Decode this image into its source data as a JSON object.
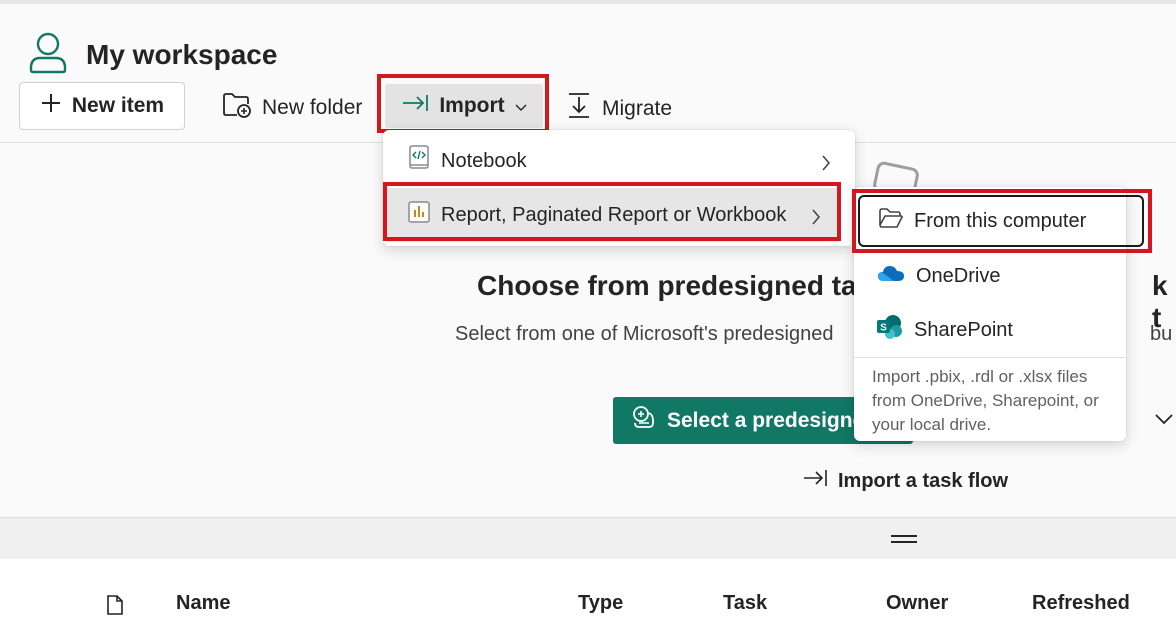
{
  "workspace": {
    "title": "My workspace"
  },
  "toolbar": {
    "new_item": "New item",
    "new_folder": "New folder",
    "import": "Import",
    "migrate": "Migrate"
  },
  "import_menu": {
    "items": [
      {
        "label": "Notebook",
        "icon": "notebook-icon"
      },
      {
        "label": "Report, Paginated Report or Workbook",
        "icon": "report-icon"
      }
    ]
  },
  "import_submenu": {
    "items": [
      {
        "label": "From this computer",
        "icon": "folder-open-icon"
      },
      {
        "label": "OneDrive",
        "icon": "onedrive-icon"
      },
      {
        "label": "SharePoint",
        "icon": "sharepoint-icon"
      }
    ],
    "description": "Import .pbix, .rdl or .xlsx files from OneDrive, Sharepoint, or your local drive."
  },
  "main": {
    "title": "Choose from predesigned ta",
    "title_tail": "k t",
    "subtitle": "Select from one of Microsoft's predesigned",
    "subtitle_tail": "bu",
    "select_button": "Select a predesigne",
    "import_task_flow": "Import a task flow"
  },
  "table": {
    "headers": [
      "Name",
      "Type",
      "Task",
      "Owner",
      "Refreshed"
    ]
  },
  "colors": {
    "highlight_red": "#d4171e",
    "brand_green": "#117865",
    "onedrive_blue": "#0f6cbd",
    "sharepoint_teal": "#03787c"
  }
}
